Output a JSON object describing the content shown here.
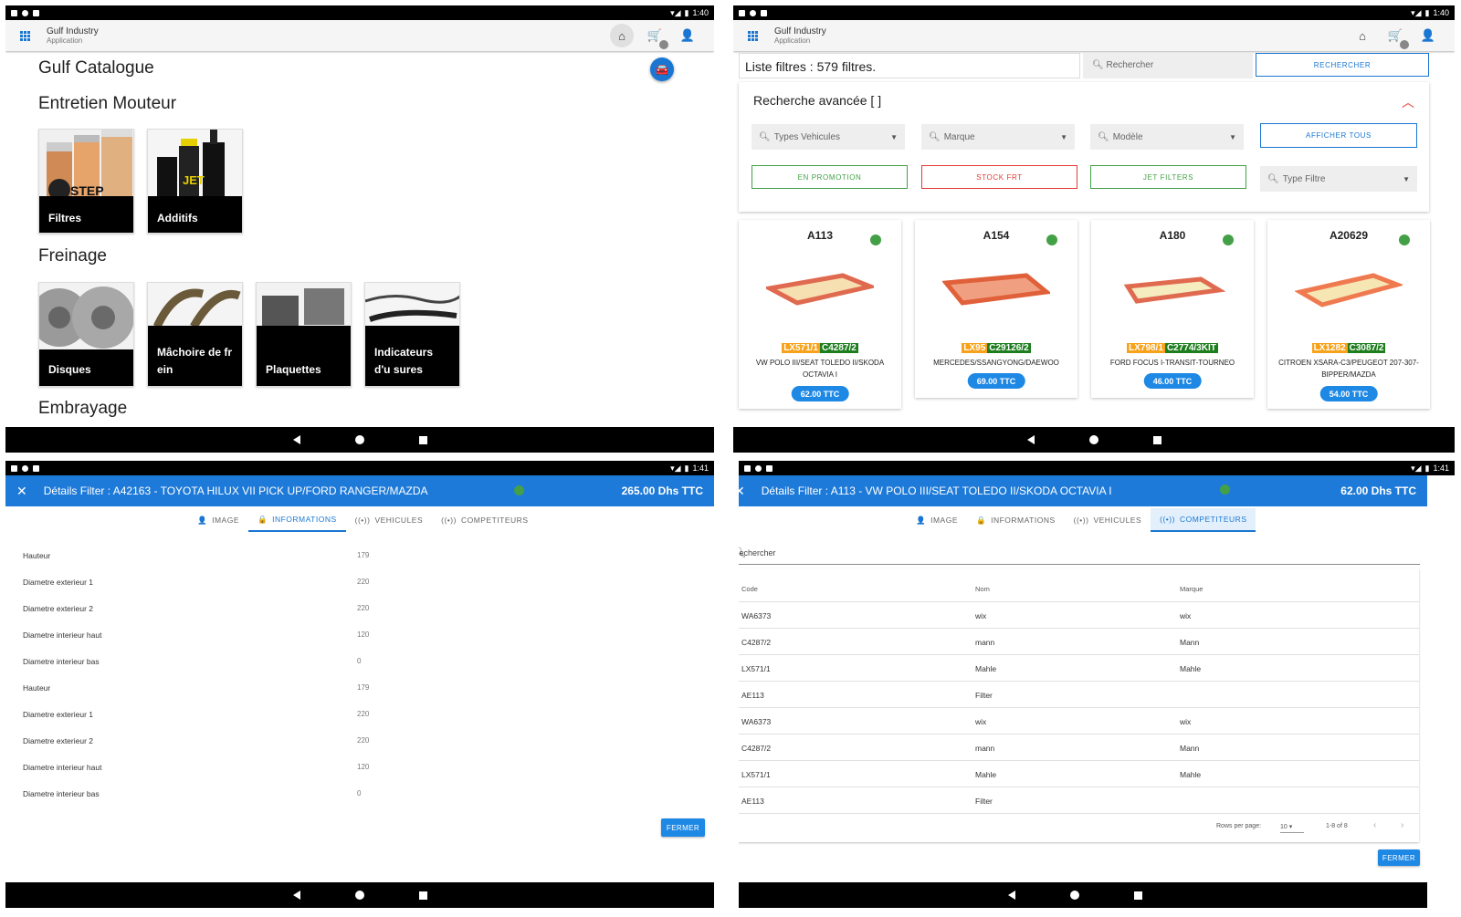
{
  "status": {
    "p1_time": "1:40",
    "p2_time": "1:40",
    "p3_time": "1:41",
    "p4_time": "1:41"
  },
  "app": {
    "name": "Gulf Industry",
    "subtitle": "Application"
  },
  "catalogue": {
    "title": "Gulf Catalogue",
    "sections": {
      "entretien": "Entretien Mouteur",
      "freinage": "Freinage",
      "embrayage": "Embrayage"
    },
    "entretien_items": [
      "Filtres",
      "Additifs"
    ],
    "freinage_items": [
      "Disques",
      "Mâchoire de fr ein",
      "Plaquettes",
      "Indicateurs d'u sures"
    ]
  },
  "filters": {
    "list_label": "Liste filtres : 579 filtres.",
    "search_placeholder": "Rechercher",
    "search_button": "RECHERCHER",
    "advanced_title": "Recherche avancée [ ]",
    "selects": {
      "types": "Types Vehicules",
      "marque": "Marque",
      "modele": "Modèle",
      "type_filtre": "Type Filtre"
    },
    "buttons": {
      "afficher": "AFFICHER TOUS",
      "promo": "EN PROMOTION",
      "stock": "STOCK FRT",
      "jet": "JET FILTERS"
    },
    "products": [
      {
        "code": "A113",
        "ref1": "LX571/1",
        "ref2": "C4287/2",
        "desc": "VW POLO III/SEAT TOLEDO II/SKODA OCTAVIA I",
        "price": "62.00 TTC"
      },
      {
        "code": "A154",
        "ref1": "LX95",
        "ref2": "C29126/2",
        "desc": "MERCEDES/SSANGYONG/DAEWOO",
        "price": "69.00 TTC"
      },
      {
        "code": "A180",
        "ref1": "LX798/1",
        "ref2": "C2774/3KIT",
        "desc": "FORD FOCUS I-TRANSIT-TOURNEO",
        "price": "46.00 TTC"
      },
      {
        "code": "A20629",
        "ref1": "LX1282",
        "ref2": "C3087/2",
        "desc": "CITROEN XSARA-C3/PEUGEOT 207-307-BIPPER/MAZDA",
        "price": "54.00 TTC"
      }
    ]
  },
  "detail1": {
    "title": "Détails Filter : A42163 - TOYOTA HILUX VII PICK UP/FORD RANGER/MAZDA",
    "price": "265.00 Dhs TTC",
    "tabs": [
      "IMAGE",
      "INFORMATIONS",
      "VEHICULES",
      "COMPETITEURS"
    ],
    "rows": [
      {
        "label": "Hauteur",
        "value": "179"
      },
      {
        "label": "Diametre exterieur 1",
        "value": "220"
      },
      {
        "label": "Diametre exterieur 2",
        "value": "220"
      },
      {
        "label": "Diametre interieur haut",
        "value": "120"
      },
      {
        "label": "Diametre interieur bas",
        "value": "0"
      },
      {
        "label": "Hauteur",
        "value": "179"
      },
      {
        "label": "Diametre exterieur 1",
        "value": "220"
      },
      {
        "label": "Diametre exterieur 2",
        "value": "220"
      },
      {
        "label": "Diametre interieur haut",
        "value": "120"
      },
      {
        "label": "Diametre interieur bas",
        "value": "0"
      }
    ],
    "close": "FERMER"
  },
  "detail2": {
    "title": "Détails Filter : A113 - VW POLO III/SEAT TOLEDO II/SKODA OCTAVIA I",
    "price": "62.00 Dhs TTC",
    "tabs": [
      "IMAGE",
      "INFORMATIONS",
      "VEHICULES",
      "COMPETITEURS"
    ],
    "search_label": "Rechercher",
    "columns": [
      "Code",
      "Nom",
      "Marque"
    ],
    "rows": [
      [
        "WA6373",
        "wix",
        "wix"
      ],
      [
        "C4287/2",
        "mann",
        "Mann"
      ],
      [
        "LX571/1",
        "Mahle",
        "Mahle"
      ],
      [
        "AE113",
        "Filter",
        ""
      ],
      [
        "WA6373",
        "wix",
        "wix"
      ],
      [
        "C4287/2",
        "mann",
        "Mann"
      ],
      [
        "LX571/1",
        "Mahle",
        "Mahle"
      ],
      [
        "AE113",
        "Filter",
        ""
      ]
    ],
    "rows_per_page_label": "Rows per page:",
    "rows_per_page": "10",
    "range": "1-8 of 8",
    "close": "FERMER"
  }
}
